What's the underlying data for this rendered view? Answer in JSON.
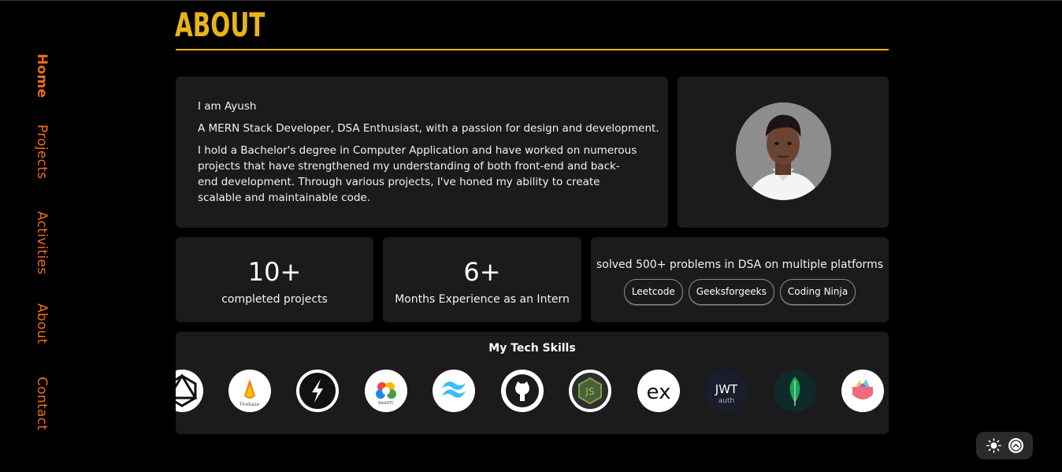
{
  "nav": {
    "items": [
      {
        "label": "Home",
        "active": true
      },
      {
        "label": "Projects",
        "active": false
      },
      {
        "label": "Activities",
        "active": false
      },
      {
        "label": "About",
        "active": false
      },
      {
        "label": "Contact",
        "active": false
      }
    ]
  },
  "section": {
    "title": "ABOUT"
  },
  "intro": {
    "greeting": "I am Ayush",
    "tagline": "A MERN Stack Developer, DSA Enthusiast, with a passion for design and development.",
    "bio": "I hold a Bachelor's degree in Computer Application and have worked on numerous projects that have strengthened my understanding of both front-end and back-end development. Through various projects, I've honed my ability to create scalable and maintainable code."
  },
  "stats": [
    {
      "value": "10+",
      "label": "completed projects"
    },
    {
      "value": "6+",
      "label": "Months Experience as an Intern"
    }
  ],
  "dsa": {
    "text": "solved 500+ problems in DSA on multiple platforms",
    "platforms": [
      "Leetcode",
      "Geeksforgeeks",
      "Coding Ninja"
    ]
  },
  "skills": {
    "title": "My Tech Skills",
    "items": [
      {
        "icon": "graphql-icon"
      },
      {
        "icon": "firebase-icon",
        "caption": "Firebase"
      },
      {
        "icon": "socketio-icon"
      },
      {
        "icon": "webrtc-icon",
        "caption": "WebRTC"
      },
      {
        "icon": "tailwind-icon"
      },
      {
        "icon": "github-icon"
      },
      {
        "icon": "nodejs-icon",
        "caption": "JS"
      },
      {
        "icon": "express-icon",
        "caption": "ex"
      },
      {
        "icon": "jwt-icon",
        "caption": "JWT",
        "subcaption": "auth"
      },
      {
        "icon": "mongodb-icon"
      },
      {
        "icon": "redux-toolkit-icon"
      }
    ]
  },
  "colors": {
    "accent": "#e8b31b",
    "nav": "#f26b1d",
    "card": "#1b1b1d",
    "background": "#000000"
  }
}
